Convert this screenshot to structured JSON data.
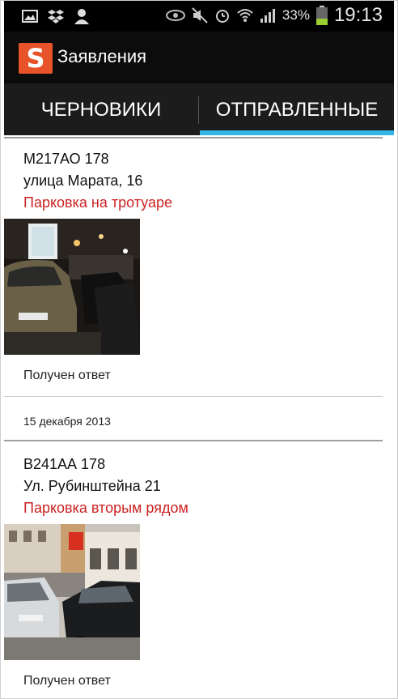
{
  "statusbar": {
    "battery_percent": "33%",
    "time": "19:13",
    "left_icons": [
      "image-icon",
      "dropbox-icon",
      "person-icon"
    ],
    "right_icons": [
      "eye-icon",
      "mute-icon",
      "alarm-icon",
      "wifi-icon",
      "signal-icon",
      "battery-icon"
    ]
  },
  "app": {
    "title": "Заявления",
    "logo_glyph": "S",
    "accent_color": "#e8542a"
  },
  "tabs": [
    {
      "label": "ЧЕРНОВИКИ",
      "selected": false
    },
    {
      "label": "ОТПРАВЛЕННЫЕ",
      "selected": true
    }
  ],
  "tab_indicator_color": "#33b5e5",
  "reports": [
    {
      "plate": "М217АО 178",
      "address": "улица Марата, 16",
      "violation": "Парковка на тротуаре",
      "status": "Получен ответ"
    },
    {
      "plate": "В241АА 178",
      "address": "Ул. Рубинштейна 21",
      "violation": "Парковка вторым рядом",
      "status": "Получен ответ"
    }
  ],
  "date_header": "15 декабря 2013",
  "violation_color": "#cc2222"
}
